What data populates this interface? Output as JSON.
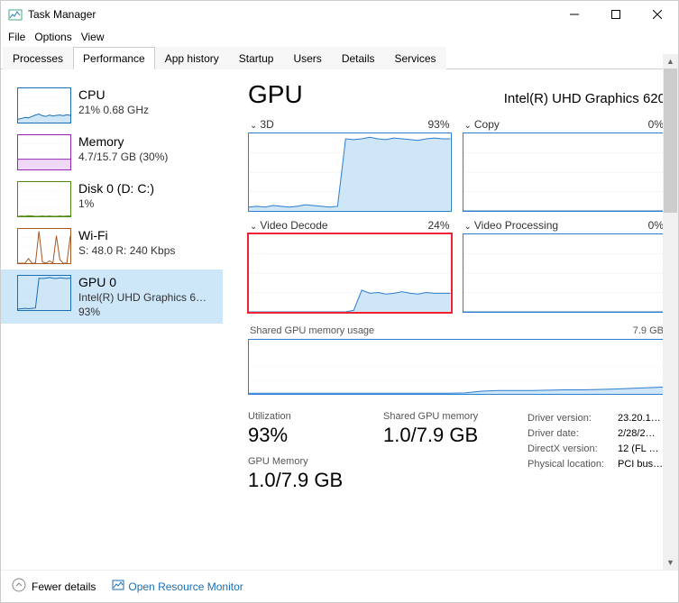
{
  "window": {
    "title": "Task Manager"
  },
  "menu": {
    "file": "File",
    "options": "Options",
    "view": "View"
  },
  "tabs": [
    "Processes",
    "Performance",
    "App history",
    "Startup",
    "Users",
    "Details",
    "Services"
  ],
  "active_tab": "Performance",
  "sidebar": {
    "items": [
      {
        "title": "CPU",
        "sub": "21% 0.68 GHz"
      },
      {
        "title": "Memory",
        "sub": "4.7/15.7 GB (30%)"
      },
      {
        "title": "Disk 0 (D: C:)",
        "sub": "1%"
      },
      {
        "title": "Wi-Fi",
        "sub": "S: 48.0 R: 240 Kbps"
      },
      {
        "title": "GPU 0",
        "sub": "Intel(R) UHD Graphics 6…",
        "sub2": "93%"
      }
    ]
  },
  "main": {
    "heading": "GPU",
    "device": "Intel(R) UHD Graphics 620",
    "engines": [
      {
        "name": "3D",
        "pct": "93%"
      },
      {
        "name": "Copy",
        "pct": "0%"
      },
      {
        "name": "Video Decode",
        "pct": "24%"
      },
      {
        "name": "Video Processing",
        "pct": "0%"
      }
    ],
    "shared_label": "Shared GPU memory usage",
    "shared_max": "7.9 GB",
    "stats": {
      "util_label": "Utilization",
      "util_val": "93%",
      "gmem_label": "GPU Memory",
      "gmem_val": "1.0/7.9 GB",
      "shared_label": "Shared GPU memory",
      "shared_val": "1.0/7.9 GB"
    },
    "kv": [
      {
        "k": "Driver version:",
        "v": "23.20.1…"
      },
      {
        "k": "Driver date:",
        "v": "2/28/2…"
      },
      {
        "k": "DirectX version:",
        "v": "12 (FL …"
      },
      {
        "k": "Physical location:",
        "v": "PCI bus…"
      }
    ]
  },
  "footer": {
    "fewer": "Fewer details",
    "orm": "Open Resource Monitor"
  },
  "chart_data": {
    "engines": [
      {
        "name": "3D",
        "type": "area",
        "ylim": [
          0,
          100
        ],
        "values": [
          5,
          6,
          5,
          7,
          6,
          5,
          6,
          8,
          7,
          6,
          5,
          6,
          93,
          92,
          93,
          95,
          93,
          92,
          94,
          93,
          92,
          91,
          93,
          94,
          93,
          93
        ]
      },
      {
        "name": "Copy",
        "type": "area",
        "ylim": [
          0,
          100
        ],
        "values": [
          0,
          0,
          0,
          0,
          0,
          0,
          0,
          0,
          0,
          0,
          0,
          0,
          0,
          0,
          0,
          0,
          0,
          0,
          0,
          0,
          0,
          0,
          0,
          0,
          0,
          0
        ]
      },
      {
        "name": "Video Decode",
        "type": "area",
        "ylim": [
          0,
          100
        ],
        "values": [
          0,
          0,
          0,
          0,
          0,
          0,
          0,
          0,
          0,
          0,
          0,
          0,
          0,
          2,
          28,
          24,
          25,
          23,
          24,
          26,
          24,
          23,
          25,
          24,
          24,
          24
        ]
      },
      {
        "name": "Video Processing",
        "type": "area",
        "ylim": [
          0,
          100
        ],
        "values": [
          0,
          0,
          0,
          0,
          0,
          0,
          0,
          0,
          0,
          0,
          0,
          0,
          0,
          0,
          0,
          0,
          0,
          0,
          0,
          0,
          0,
          0,
          0,
          0,
          0,
          0
        ]
      }
    ],
    "shared_memory": {
      "type": "area",
      "ylim": [
        0,
        7.9
      ],
      "unit": "GB",
      "values": [
        0.1,
        0.1,
        0.1,
        0.1,
        0.1,
        0.1,
        0.1,
        0.1,
        0.1,
        0.1,
        0.1,
        0.1,
        0.1,
        0.15,
        0.4,
        0.5,
        0.5,
        0.5,
        0.55,
        0.6,
        0.6,
        0.65,
        0.7,
        0.8,
        0.9,
        1.0
      ]
    },
    "sidebar_sparks": {
      "cpu": {
        "ylim": [
          0,
          100
        ],
        "values": [
          10,
          12,
          15,
          14,
          18,
          22,
          25,
          20,
          18,
          22,
          19,
          21,
          22,
          20,
          23,
          21
        ]
      },
      "memory": {
        "ylim": [
          0,
          100
        ],
        "values": [
          30,
          30,
          30,
          30,
          30,
          30,
          30,
          30,
          30,
          30,
          30,
          30,
          30,
          30,
          30,
          30
        ]
      },
      "disk": {
        "ylim": [
          0,
          100
        ],
        "values": [
          0,
          1,
          0,
          2,
          1,
          0,
          0,
          1,
          0,
          1,
          0,
          0,
          1,
          0,
          1,
          1
        ]
      },
      "wifi": {
        "ylim": [
          0,
          300
        ],
        "values": [
          0,
          0,
          0,
          40,
          0,
          0,
          280,
          10,
          0,
          20,
          0,
          240,
          30,
          0,
          0,
          240
        ]
      },
      "gpu": {
        "ylim": [
          0,
          100
        ],
        "values": [
          3,
          4,
          5,
          4,
          5,
          6,
          93,
          92,
          93,
          95,
          93,
          92,
          94,
          93,
          92,
          93
        ]
      }
    }
  }
}
